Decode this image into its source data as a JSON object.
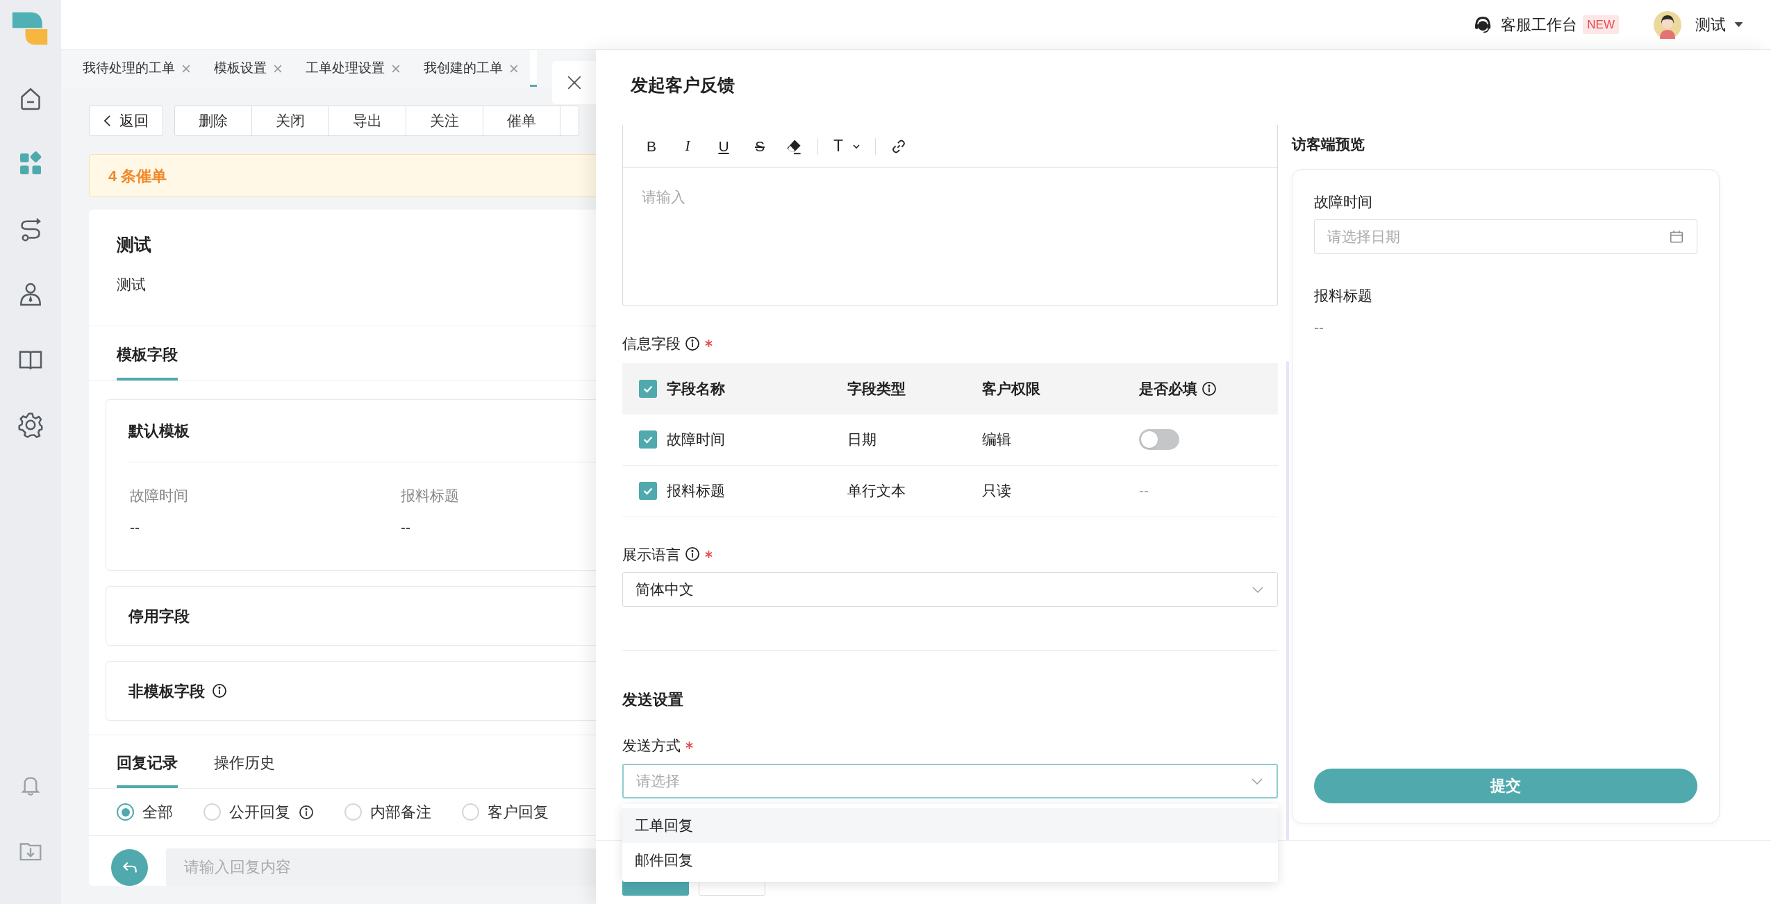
{
  "sidebar": {
    "items": [
      {
        "selected": false
      },
      {
        "selected": true
      },
      {
        "selected": false
      },
      {
        "selected": false
      },
      {
        "selected": false
      },
      {
        "selected": false
      }
    ],
    "bottom_items": [
      {
        "selected": false
      },
      {
        "selected": false
      }
    ]
  },
  "top_bar": {
    "workbench": "客服工作台",
    "badge": "NEW",
    "user": "测试"
  },
  "tabs": [
    {
      "label": "我待处理的工单",
      "selected": false
    },
    {
      "label": "模板设置",
      "selected": false
    },
    {
      "label": "工单处理设置",
      "selected": false
    },
    {
      "label": "我创建的工单",
      "selected": false
    },
    {
      "selected": true
    }
  ],
  "toolbar": {
    "back": "返回",
    "actions": [
      "删除",
      "关闭",
      "导出",
      "关注",
      "催单"
    ]
  },
  "alert": "4 条催单",
  "ticket": {
    "title": "测试",
    "description": "测试"
  },
  "detail_tabs": [
    {
      "label": "模板字段",
      "selected": true
    }
  ],
  "sections": [
    {
      "title": "默认模板",
      "info": false,
      "fields": [
        {
          "label": "故障时间",
          "value": "--"
        },
        {
          "label": "报料标题",
          "value": "--"
        }
      ]
    },
    {
      "title": "停用字段",
      "info": false
    },
    {
      "title": "非模板字段",
      "info": true
    }
  ],
  "record_tabs": [
    {
      "label": "回复记录",
      "selected": true
    },
    {
      "label": "操作历史",
      "selected": false
    }
  ],
  "filters": [
    {
      "label": "全部",
      "selected": true,
      "info": false
    },
    {
      "label": "公开回复",
      "selected": false,
      "info": true
    },
    {
      "label": "内部备注",
      "selected": false,
      "info": false
    },
    {
      "label": "客户回复",
      "selected": false,
      "info": false
    }
  ],
  "reply": {
    "placeholder": "请输入回复内容"
  },
  "drawer": {
    "title": "发起客户反馈",
    "editor": {
      "tools": [
        {
          "kind": "bold",
          "glyph": "B"
        },
        {
          "kind": "italic",
          "glyph": "I"
        },
        {
          "kind": "underline",
          "glyph": "U"
        },
        {
          "kind": "strike",
          "glyph": "S"
        },
        {
          "kind": "eraser"
        },
        {
          "kind": "separator"
        },
        {
          "kind": "heading",
          "glyph": "T"
        },
        {
          "kind": "separator"
        },
        {
          "kind": "link"
        }
      ],
      "placeholder": "请输入"
    },
    "info_fields": {
      "label": "信息字段",
      "required": true,
      "all_checked": true,
      "columns": [
        "字段名称",
        "字段类型",
        "客户权限",
        "是否必填"
      ],
      "rows": [
        {
          "checked": true,
          "name": "故障时间",
          "type": "日期",
          "permission": "编辑",
          "kind": "switch",
          "on": false
        },
        {
          "checked": true,
          "name": "报料标题",
          "type": "单行文本",
          "permission": "只读",
          "kind": "text",
          "value": "--"
        }
      ]
    },
    "language": {
      "label": "展示语言",
      "required": true,
      "value": "简体中文"
    },
    "send_title": "发送设置",
    "send_method": {
      "label": "发送方式",
      "required": true,
      "placeholder": "请选择",
      "expanded": true,
      "options": [
        {
          "label": "工单回复",
          "highlighted": true
        },
        {
          "label": "邮件回复",
          "highlighted": false
        }
      ]
    }
  },
  "preview": {
    "title": "访客端预览",
    "fields": [
      {
        "kind": "date",
        "label": "故障时间",
        "placeholder": "请选择日期"
      },
      {
        "kind": "text",
        "label": "报料标题",
        "value": "--"
      }
    ],
    "submit": "提交"
  }
}
